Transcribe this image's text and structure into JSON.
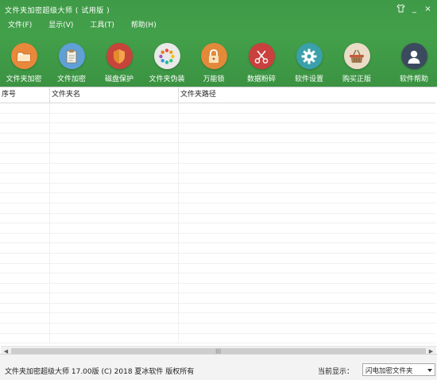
{
  "window": {
    "title": "文件夹加密超级大师 ( 试用版 )",
    "skin_icon": "shirt-icon",
    "minimize": "_",
    "close": "×"
  },
  "menu": [
    {
      "label": "文件(F)"
    },
    {
      "label": "显示(V)"
    },
    {
      "label": "工具(T)"
    },
    {
      "label": "帮助(H)"
    }
  ],
  "toolbar": [
    {
      "label": "文件夹加密",
      "icon": "folder-icon",
      "color": "#e8883a"
    },
    {
      "label": "文件加密",
      "icon": "clipboard-icon",
      "color": "#5fa0d6"
    },
    {
      "label": "磁盘保护",
      "icon": "shield-icon",
      "color": "#c7443b"
    },
    {
      "label": "文件夹伪装",
      "icon": "color-wheel-icon",
      "color": "#e9e9e9"
    },
    {
      "label": "万能锁",
      "icon": "lock-icon",
      "color": "#e28a3a"
    },
    {
      "label": "数据粉碎",
      "icon": "scissors-icon",
      "color": "#c9403e"
    },
    {
      "label": "软件设置",
      "icon": "gear-icon",
      "color": "#3aa0a9"
    },
    {
      "label": "购买正版",
      "icon": "basket-icon",
      "color": "#eadcc6"
    },
    {
      "label": "软件帮助",
      "icon": "user-icon",
      "color": "#3b4a5e"
    }
  ],
  "table": {
    "columns": [
      "序号",
      "文件夹名",
      "文件夹路径"
    ],
    "rows": []
  },
  "status": {
    "text": "文件夹加密超级大师 17.00版 (C) 2018 夏冰软件 版权所有",
    "current_label": "当前显示：",
    "current_value": "闪电加密文件夹"
  }
}
